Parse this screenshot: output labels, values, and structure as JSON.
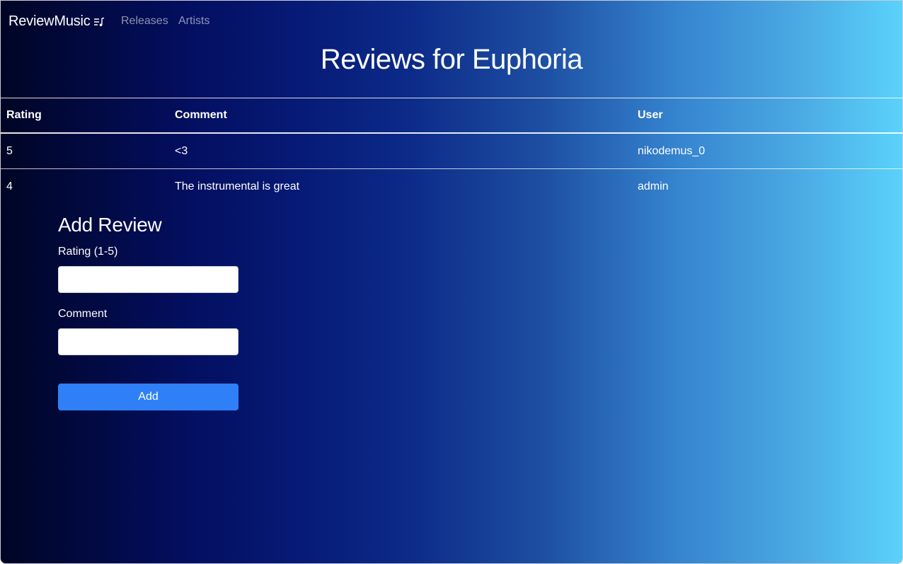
{
  "navbar": {
    "brand": "ReviewMusic",
    "brand_icon": "music-playlist-icon",
    "links": [
      "Releases",
      "Artists"
    ]
  },
  "page": {
    "title": "Reviews for Euphoria"
  },
  "table": {
    "headers": [
      "Rating",
      "Comment",
      "User"
    ],
    "rows": [
      {
        "rating": "5",
        "comment": "<3",
        "user": "nikodemus_0"
      },
      {
        "rating": "4",
        "comment": "The instrumental is great",
        "user": "admin"
      }
    ]
  },
  "form": {
    "title": "Add Review",
    "rating_label": "Rating (1-5)",
    "rating_value": "",
    "comment_label": "Comment",
    "comment_value": "",
    "submit_label": "Add"
  },
  "colors": {
    "gradient_start": "#000525",
    "gradient_end": "#5ad2fb",
    "button": "#2f80f6"
  }
}
